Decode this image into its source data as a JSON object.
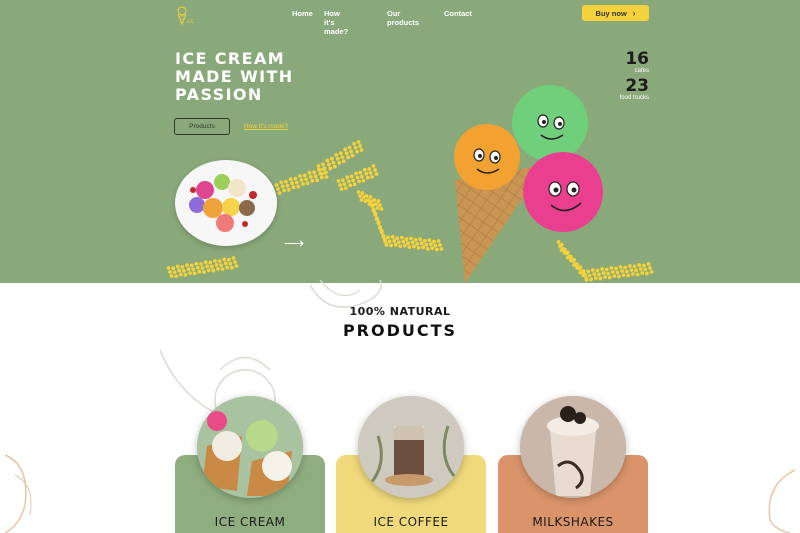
{
  "nav": {
    "items": [
      "Home",
      "How it's made?",
      "Our products",
      "Contact"
    ],
    "buy_label": "Buy now"
  },
  "hero": {
    "title_lines": [
      "ICE CREAM",
      "MADE WITH",
      "PASSION"
    ],
    "products_button": "Products",
    "how_link": "How it's made?",
    "stats": [
      {
        "num": "16",
        "label": "cafes"
      },
      {
        "num": "23",
        "label": "food trucks"
      }
    ]
  },
  "products": {
    "subtitle": "100% NATURAL",
    "title": "PRODUCTS",
    "cards": [
      {
        "name": "ICE CREAM"
      },
      {
        "name": "ICE COFFEE"
      },
      {
        "name": "MILKSHAKES"
      }
    ]
  },
  "colors": {
    "hero_bg": "#8aa97a",
    "accent_yellow": "#f3d23b",
    "card_green": "#8fae7f",
    "card_yellow": "#f0d97a",
    "card_orange": "#db946a"
  },
  "icons": [
    "ice-cream-logo-icon",
    "chevron-right-icon",
    "arrow-right-icon"
  ]
}
